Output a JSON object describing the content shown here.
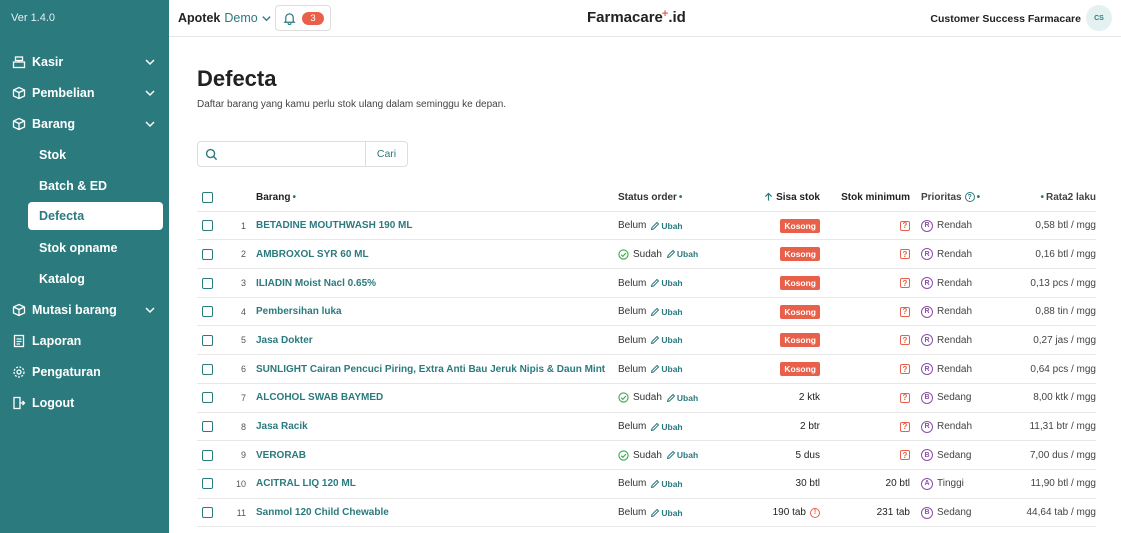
{
  "sidebar": {
    "version": "Ver 1.4.0",
    "items": [
      {
        "label": "Kasir",
        "icon": "register-icon",
        "chevron": true
      },
      {
        "label": "Pembelian",
        "icon": "box-icon",
        "chevron": true
      },
      {
        "label": "Barang",
        "icon": "package-icon",
        "chevron": true
      },
      {
        "label": "Stok",
        "sub": true
      },
      {
        "label": "Batch & ED",
        "sub": true
      },
      {
        "label": "Defecta",
        "sub": true,
        "active": true
      },
      {
        "label": "Stok opname",
        "sub": true
      },
      {
        "label": "Katalog",
        "sub": true
      },
      {
        "label": "Mutasi barang",
        "icon": "transfer-icon",
        "chevron": true
      },
      {
        "label": "Laporan",
        "icon": "report-icon"
      },
      {
        "label": "Pengaturan",
        "icon": "gear-icon"
      },
      {
        "label": "Logout",
        "icon": "logout-icon"
      }
    ]
  },
  "topbar": {
    "store_name": "Apotek",
    "store_variant": "Demo",
    "notification_count": "3",
    "brand": "Farmacare",
    "brand_suffix": "id",
    "brand_plus": "+",
    "user_name": "Customer Success Farmacare",
    "avatar_initials": "CS"
  },
  "main": {
    "title": "Defecta",
    "subtitle": "Daftar barang yang kamu perlu stok ulang dalam seminggu ke depan.",
    "search_placeholder": "",
    "search_button": "Cari"
  },
  "table": {
    "headers": {
      "barang": "Barang",
      "status": "Status order",
      "sisa": "Sisa stok",
      "minimum": "Stok minimum",
      "prioritas": "Prioritas",
      "rata": "Rata2 laku",
      "dot": "•",
      "help": "?"
    },
    "edit_label": "Ubah",
    "kosong_label": "Kosong",
    "rows": [
      {
        "no": "1",
        "name": "BETADINE MOUTHWASH 190 ML",
        "status": "Belum",
        "done": false,
        "sisa": "Kosong",
        "empty": true,
        "minimum": "?",
        "prio_letter": "R",
        "prio": "Rendah",
        "rata": "0,58 btl / mgg"
      },
      {
        "no": "2",
        "name": "AMBROXOL SYR 60 ML",
        "status": "Sudah",
        "done": true,
        "sisa": "Kosong",
        "empty": true,
        "minimum": "?",
        "prio_letter": "R",
        "prio": "Rendah",
        "rata": "0,16 btl / mgg"
      },
      {
        "no": "3",
        "name": "ILIADIN Moist Nacl 0.65%",
        "status": "Belum",
        "done": false,
        "sisa": "Kosong",
        "empty": true,
        "minimum": "?",
        "prio_letter": "R",
        "prio": "Rendah",
        "rata": "0,13 pcs / mgg"
      },
      {
        "no": "4",
        "name": "Pembersihan luka",
        "status": "Belum",
        "done": false,
        "sisa": "Kosong",
        "empty": true,
        "minimum": "?",
        "prio_letter": "R",
        "prio": "Rendah",
        "rata": "0,88 tin / mgg"
      },
      {
        "no": "5",
        "name": "Jasa Dokter",
        "status": "Belum",
        "done": false,
        "sisa": "Kosong",
        "empty": true,
        "minimum": "?",
        "prio_letter": "R",
        "prio": "Rendah",
        "rata": "0,27 jas / mgg"
      },
      {
        "no": "6",
        "name": "SUNLIGHT Cairan Pencuci Piring, Extra Anti Bau Jeruk Nipis & Daun Mint",
        "status": "Belum",
        "done": false,
        "sisa": "Kosong",
        "empty": true,
        "minimum": "?",
        "prio_letter": "R",
        "prio": "Rendah",
        "rata": "0,64 pcs / mgg"
      },
      {
        "no": "7",
        "name": "ALCOHOL SWAB BAYMED",
        "status": "Sudah",
        "done": true,
        "sisa": "2 ktk",
        "empty": false,
        "minimum": "?",
        "prio_letter": "B",
        "prio": "Sedang",
        "rata": "8,00 ktk / mgg"
      },
      {
        "no": "8",
        "name": "Jasa Racik",
        "status": "Belum",
        "done": false,
        "sisa": "2 btr",
        "empty": false,
        "minimum": "?",
        "prio_letter": "R",
        "prio": "Rendah",
        "rata": "11,31 btr / mgg"
      },
      {
        "no": "9",
        "name": "VERORAB",
        "status": "Sudah",
        "done": true,
        "sisa": "5 dus",
        "empty": false,
        "minimum": "?",
        "prio_letter": "B",
        "prio": "Sedang",
        "rata": "7,00 dus / mgg"
      },
      {
        "no": "10",
        "name": "ACITRAL LIQ 120 ML",
        "status": "Belum",
        "done": false,
        "sisa": "30 btl",
        "empty": false,
        "minimum": "20 btl",
        "prio_letter": "A",
        "prio": "Tinggi",
        "rata": "11,90 btl / mgg"
      },
      {
        "no": "11",
        "name": "Sanmol 120 Child Chewable",
        "status": "Belum",
        "done": false,
        "sisa": "190 tab",
        "empty": false,
        "warn": true,
        "minimum": "231 tab",
        "prio_letter": "B",
        "prio": "Sedang",
        "rata": "44,64 tab / mgg"
      }
    ]
  },
  "colors": {
    "primary": "#2a7a7e",
    "accent": "#e8604a",
    "priority": "#8a4fa8"
  }
}
